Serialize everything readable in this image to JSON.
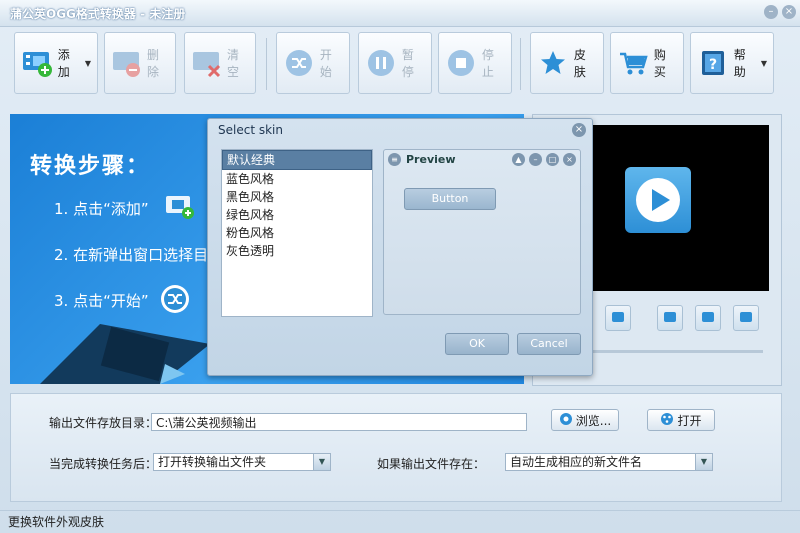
{
  "window": {
    "title": "蒲公英OGG格式转换器 - 未注册"
  },
  "toolbar": {
    "add": "添加",
    "delete": "删除",
    "clear": "清空",
    "start": "开始",
    "pause": "暂停",
    "stop": "停止",
    "skin": "皮肤",
    "buy": "购买",
    "help": "帮助"
  },
  "guide": {
    "title": "转换步骤：",
    "step1": "1. 点击“添加”",
    "step2": "2. 在新弹出窗口选择目",
    "step3": "3. 点击“开始”"
  },
  "output": {
    "dir_label": "输出文件存放目录：",
    "dir_value": "C:\\蒲公英视频输出",
    "browse": "浏览...",
    "open": "打开",
    "after_label": "当完成转换任务后：",
    "after_value": "打开转换输出文件夹",
    "exists_label": "如果输出文件存在：",
    "exists_value": "自动生成相应的新文件名"
  },
  "status": {
    "text": "更换软件外观皮肤"
  },
  "dialog": {
    "title": "Select skin",
    "skins": [
      "默认经典",
      "蓝色风格",
      "黑色风格",
      "绿色风格",
      "粉色风格",
      "灰色透明"
    ],
    "preview_title": "Preview",
    "preview_button": "Button",
    "ok": "OK",
    "cancel": "Cancel"
  },
  "colors": {
    "accent": "#2d8fd6",
    "panel_blue": "#2287de"
  }
}
